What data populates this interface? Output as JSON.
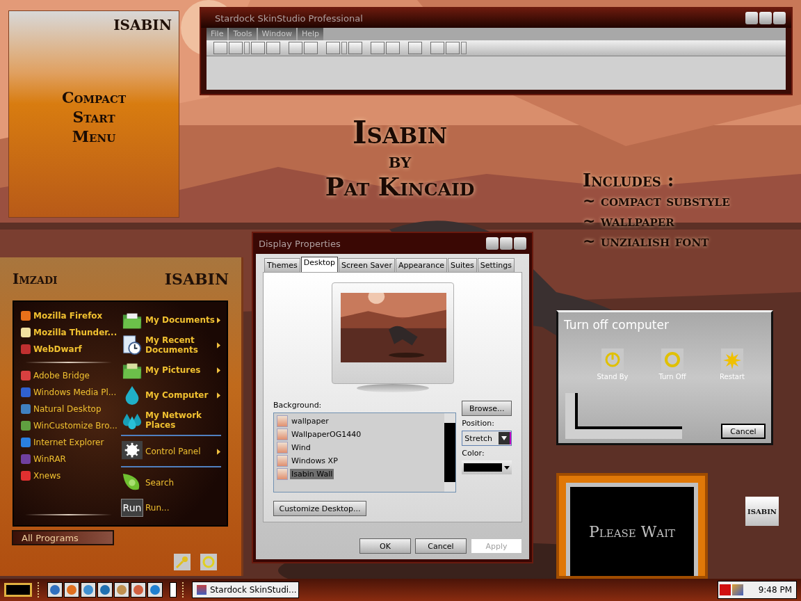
{
  "compact_panel": {
    "logo": "ISABIN",
    "lines": [
      "Compact",
      "Start",
      "Menu"
    ]
  },
  "skinstudio": {
    "title": "Stardock SkinStudio Professional",
    "menu": [
      "File",
      "Tools",
      "Window",
      "Help"
    ]
  },
  "headline": {
    "title": "Isabin",
    "by": "by",
    "author": "Pat Kincaid"
  },
  "includes": {
    "heading": "Includes :",
    "items": [
      "~ compact substyle",
      "~ wallpaper",
      "~ unzialish font"
    ]
  },
  "start_menu": {
    "user": "Imzadi",
    "logo": "ISABIN",
    "pinned": [
      "Mozilla Firefox",
      "Mozilla Thunder...",
      "WebDwarf"
    ],
    "recent": [
      "Adobe Bridge",
      "Windows Media Pl...",
      "Natural Desktop",
      "WinCustomize Bro...",
      "Internet Explorer",
      "WinRAR",
      "Xnews"
    ],
    "place_groups": [
      {
        "bold": true,
        "items": [
          {
            "label": "My Documents",
            "kind": "folder",
            "arrow": true
          },
          {
            "label": "My Recent Documents",
            "kind": "recent",
            "arrow": true
          },
          {
            "label": "My Pictures",
            "kind": "pictures",
            "arrow": true
          },
          {
            "label": "My Computer",
            "kind": "computer",
            "arrow": true
          },
          {
            "label": "My Network Places",
            "kind": "network",
            "arrow": false
          }
        ]
      },
      {
        "bold": false,
        "items": [
          {
            "label": "Control Panel",
            "kind": "gear",
            "arrow": true
          }
        ]
      },
      {
        "bold": false,
        "items": [
          {
            "label": "Search",
            "kind": "search",
            "arrow": false
          },
          {
            "label": "Run...",
            "kind": "run",
            "arrow": false,
            "badge": "Run"
          }
        ]
      }
    ],
    "all_programs": "All Programs"
  },
  "display_properties": {
    "title": "Display Properties",
    "tabs": [
      {
        "label": "Themes",
        "selected": false
      },
      {
        "label": "Desktop",
        "selected": true
      },
      {
        "label": "Screen Saver",
        "selected": false
      },
      {
        "label": "Appearance",
        "selected": false
      },
      {
        "label": "Suites",
        "selected": false
      },
      {
        "label": "Settings",
        "selected": false
      }
    ],
    "background_label": "Background:",
    "backgrounds": [
      {
        "label": "wallpaper",
        "selected": false
      },
      {
        "label": "WallpaperOG1440",
        "selected": false
      },
      {
        "label": "Wind",
        "selected": false
      },
      {
        "label": "Windows XP",
        "selected": false
      },
      {
        "label": "Isabin Wall",
        "selected": true
      }
    ],
    "browse": "Browse...",
    "position_label": "Position:",
    "position": "Stretch",
    "color_label": "Color:",
    "color": "#000000",
    "customize": "Customize Desktop...",
    "buttons": [
      {
        "label": "OK",
        "disabled": false
      },
      {
        "label": "Cancel",
        "disabled": false
      },
      {
        "label": "Apply",
        "disabled": true
      }
    ]
  },
  "turn_off": {
    "title": "Turn off computer",
    "options": [
      {
        "label": "Stand By",
        "kind": "standby"
      },
      {
        "label": "Turn Off",
        "kind": "off"
      },
      {
        "label": "Restart",
        "kind": "restart"
      }
    ],
    "cancel": "Cancel"
  },
  "please_wait": "Please Wait",
  "badge_logo": "ISABIN",
  "taskbar": {
    "task": "Stardock SkinStudi...",
    "clock": "9:48 PM"
  }
}
